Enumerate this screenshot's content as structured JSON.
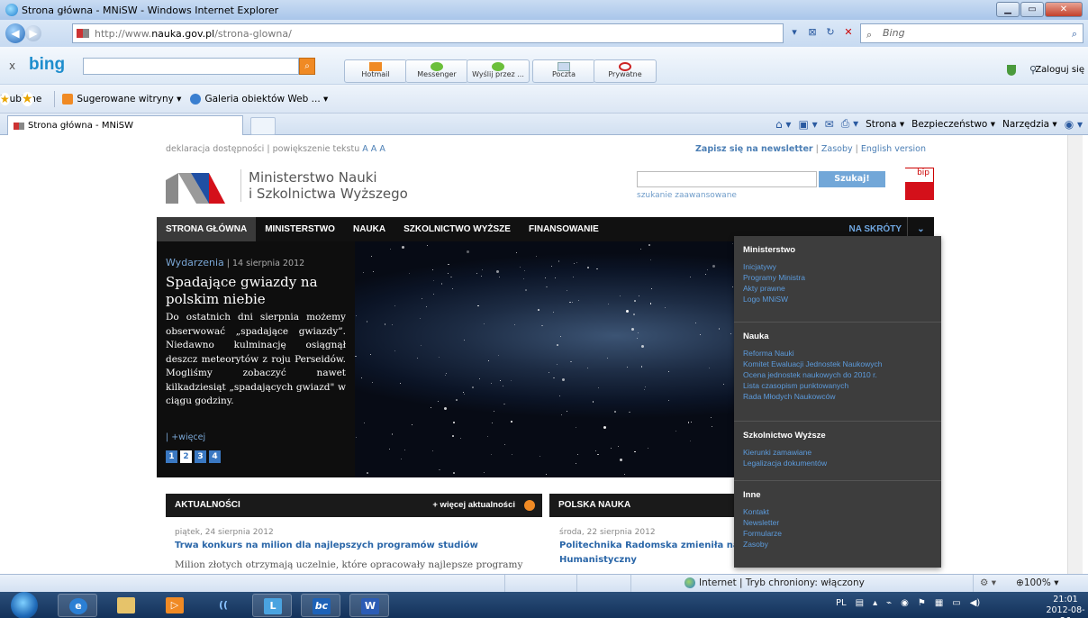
{
  "window": {
    "title": "Strona główna - MNiSW - Windows Internet Explorer"
  },
  "address": {
    "url_prefix": "http://www.",
    "url_domain": "nauka.gov.pl",
    "url_path": "/strona-glowna/",
    "search_placeholder": "Bing"
  },
  "bingbar": {
    "logo": "bing",
    "tools": [
      {
        "label": "Hotmail"
      },
      {
        "label": "Messenger"
      },
      {
        "label": "Wyślij przez ..."
      },
      {
        "label": "Poczta"
      },
      {
        "label": "Prywatne"
      }
    ],
    "login": "Zaloguj się"
  },
  "favorites": {
    "label": "Ulubione",
    "items": [
      "Sugerowane witryny ▾",
      "Galeria obiektów Web ... ▾"
    ]
  },
  "tabs": {
    "active": "Strona główna - MNiSW"
  },
  "commandbar": {
    "strona": "Strona ▾",
    "bezpieczenstwo": "Bezpieczeństwo ▾",
    "narzedzia": "Narzędzia ▾"
  },
  "site": {
    "topline": {
      "access": "deklaracja dostępności",
      "sep": "|",
      "enlarge": "powiększenie tekstu",
      "aa": "A A A"
    },
    "toplinks": {
      "newsletter": "Zapisz się na newsletter",
      "zasoby": "Zasoby",
      "english": "English version"
    },
    "logo": {
      "line1": "Ministerstwo Nauki",
      "line2": "i Szkolnictwa Wyższego"
    },
    "search": {
      "button": "Szukaj!",
      "advanced": "szukanie zaawansowane"
    },
    "bip": "bip",
    "nav": {
      "items": [
        "STRONA GŁÓWNA",
        "MINISTERSTWO",
        "NAUKA",
        "SZKOLNICTWO WYŻSZE",
        "FINANSOWANIE"
      ],
      "shortcuts": "NA SKRÓTY",
      "caret": "⌄"
    },
    "hero": {
      "category": "Wydarzenia",
      "sep": " | ",
      "date": "14 sierpnia 2012",
      "title": "Spadające gwiazdy na polskim niebie",
      "text": "Do ostatnich dni sierpnia możemy obserwować „spadające gwiazdy”. Niedawno kulminację osiągnął deszcz meteorytów z roju Perseidów. Mogliśmy zobaczyć nawet kilkadziesiąt „spadających gwiazd\" w ciągu godziny.",
      "more": "| +więcej",
      "pages": [
        "1",
        "2",
        "3",
        "4"
      ]
    },
    "news": {
      "header": "AKTUALNOŚCI",
      "more": "+ więcej aktualności",
      "date": "piątek, 24 sierpnia 2012",
      "title": "Trwa konkurs na milion dla najlepszych programów studiów",
      "text": "Milion złotych otrzymają uczelnie, które opracowały najlepsze programy"
    },
    "science": {
      "header": "POLSKA NAUKA",
      "date": "środa, 22 sierpnia 2012",
      "title": "Politechnika Radomska zmieniła nazwę",
      "title2": "Humanistyczny"
    },
    "dropdown": [
      {
        "heading": "Ministerstwo",
        "items": [
          "Inicjatywy",
          "Programy Ministra",
          "Akty prawne",
          "Logo MNiSW"
        ]
      },
      {
        "heading": "Nauka",
        "items": [
          "Reforma Nauki",
          "Komitet Ewaluacji Jednostek Naukowych",
          "Ocena jednostek naukowych do 2010 r.",
          "Lista czasopism punktowanych",
          "Rada Młodych Naukowców"
        ]
      },
      {
        "heading": "Szkolnictwo Wyższe",
        "items": [
          "Kierunki zamawiane",
          "Legalizacja dokumentów"
        ]
      },
      {
        "heading": "Inne",
        "items": [
          "Kontakt",
          "Newsletter",
          "Formularze",
          "Zasoby"
        ]
      }
    ]
  },
  "status": {
    "zone": "Internet | Tryb chroniony: włączony",
    "zoom": "100%",
    "zoom_caret": "▾"
  },
  "taskbar": {
    "lang": "PL",
    "time": "21:01",
    "date": "2012-08-26"
  }
}
